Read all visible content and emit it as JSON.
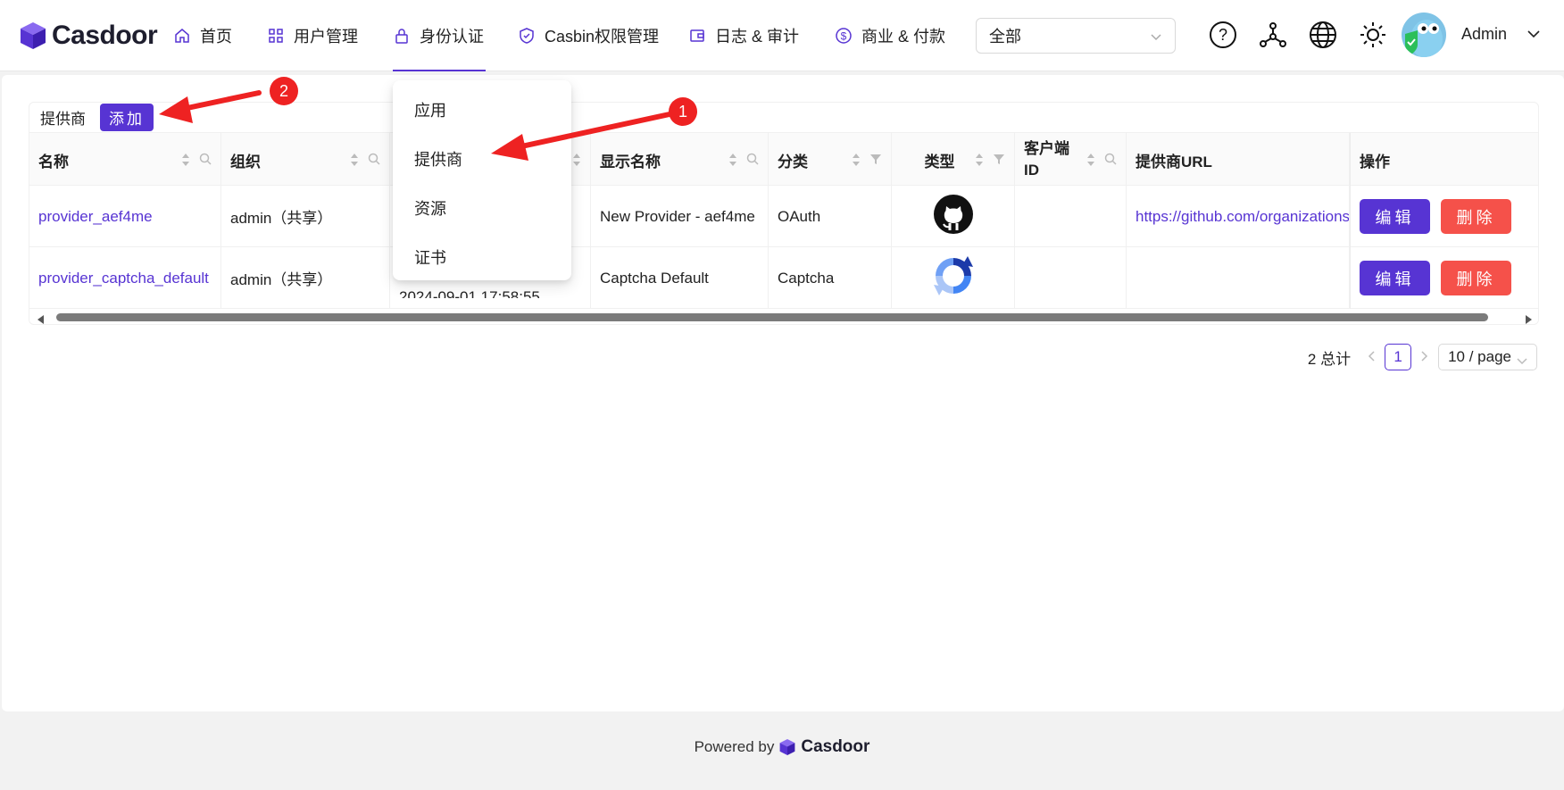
{
  "app": {
    "name": "Casdoor"
  },
  "nav": {
    "items": [
      {
        "label": "首页",
        "icon": "home-icon"
      },
      {
        "label": "用户管理",
        "icon": "grid-icon"
      },
      {
        "label": "身份认证",
        "icon": "lock-icon",
        "active": true
      },
      {
        "label": "Casbin权限管理",
        "icon": "shield-icon"
      },
      {
        "label": "日志 & 审计",
        "icon": "wallet-icon"
      },
      {
        "label": "商业 & 付款",
        "icon": "dollar-icon"
      }
    ],
    "org_select": "全部",
    "user": "Admin"
  },
  "table": {
    "title": "提供商",
    "add_label": "添加",
    "columns": [
      "名称",
      "组织",
      "显示名称",
      "分类",
      "类型",
      "客户端ID",
      "提供商URL",
      "操作"
    ],
    "rows": [
      {
        "name": "provider_aef4me",
        "org": "admin（共享）",
        "display_name": "New Provider - aef4me",
        "category": "OAuth",
        "type_icon": "github-icon",
        "client_id": "",
        "url": "https://github.com/organizations"
      },
      {
        "name": "provider_captcha_default",
        "org": "admin（共享）",
        "partial_created": "2024-09-01 17:58:55",
        "display_name": "Captcha Default",
        "category": "Captcha",
        "type_icon": "recaptcha-icon",
        "client_id": "",
        "url": ""
      }
    ],
    "edit_label": "编辑",
    "delete_label": "删除"
  },
  "pagination": {
    "total_text": "2 总计",
    "current": "1",
    "page_size": "10 / page"
  },
  "dropdown": {
    "items": [
      "应用",
      "提供商",
      "资源",
      "证书"
    ]
  },
  "annotations": {
    "badge1": "1",
    "badge2": "2"
  },
  "footer": {
    "powered_by": "Powered by",
    "brand": "Casdoor"
  },
  "colors": {
    "accent": "#5734d3",
    "danger": "#f5514a",
    "arrow": "#ee2222"
  }
}
